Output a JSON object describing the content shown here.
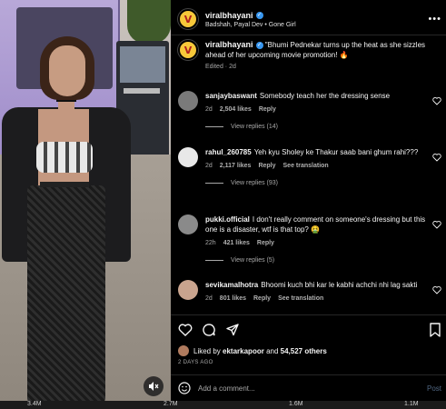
{
  "post": {
    "username": "viralbhayani",
    "audio": "Badshah, Payal Dev • Gone Girl",
    "more_label": "•••"
  },
  "caption": {
    "username": "viralbhayani",
    "text": "\"Bhumi Pednekar turns up the heat as she sizzles ahead of her upcoming movie promotion! 🔥",
    "meta": "Edited · 2d"
  },
  "comments": [
    {
      "username": "sanjaybaswant",
      "text": "Somebody teach her the dressing sense",
      "time": "2d",
      "likes": "2,504 likes",
      "reply": "Reply",
      "translate": "",
      "view_replies": "View replies (14)",
      "avatar_color": "#7a7a7a"
    },
    {
      "username": "rahul_260785",
      "text": "Yeh kyu Sholey ke Thakur saab bani ghum rahi???",
      "time": "2d",
      "likes": "2,117 likes",
      "reply": "Reply",
      "translate": "See translation",
      "view_replies": "View replies (93)",
      "avatar_color": "#e8e8e8"
    },
    {
      "username": "pukki.official",
      "text": "I don't really comment on someone's dressing but this one is a disaster, wtf is that top? 🤮",
      "time": "22h",
      "likes": "421 likes",
      "reply": "Reply",
      "translate": "",
      "view_replies": "View replies (5)",
      "avatar_color": "#8a8a8a"
    },
    {
      "username": "sevikamalhotra",
      "text": "Bhoomi kuch bhi kar le kabhi achchi nhi lag sakti",
      "time": "2d",
      "likes": "801 likes",
      "reply": "Reply",
      "translate": "See translation",
      "view_replies": "",
      "avatar_color": "#c9a48e"
    }
  ],
  "likes": {
    "prefix": "Liked by",
    "user": "ektarkapoor",
    "middle": "and",
    "count": "54,527 others"
  },
  "date": "2 DAYS AGO",
  "add_comment": {
    "placeholder": "Add a comment...",
    "post_label": "Post"
  },
  "strip": [
    "3.4M",
    "2.7M",
    "1.6M",
    "1.1M"
  ],
  "colors": {
    "background": "#000000",
    "secondary_text": "#a8a8a8",
    "verified": "#3897f0",
    "avatar_brand": "#f7c83a"
  }
}
